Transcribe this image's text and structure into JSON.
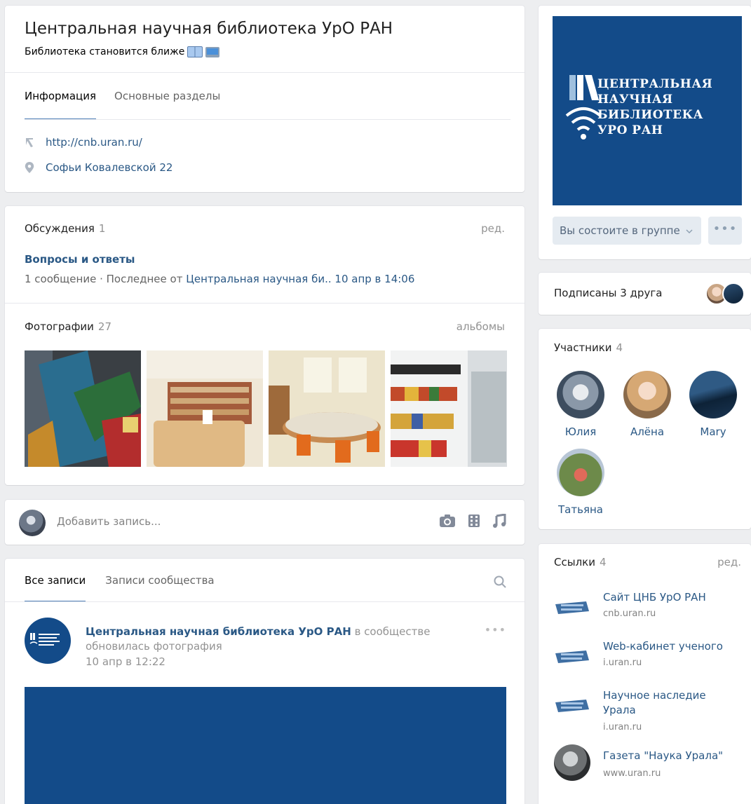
{
  "group": {
    "title": "Центральная научная библиотека УрО РАН",
    "status": "Библиотека становится ближе",
    "tabs": [
      "Информация",
      "Основные разделы"
    ],
    "website": "http://cnb.uran.ru/",
    "address": "Софьи Ковалевской 22"
  },
  "discussions": {
    "label": "Обсуждения",
    "count": "1",
    "edit": "ред.",
    "topic": "Вопросы и ответы",
    "meta_prefix": "1 сообщение · Последнее от ",
    "meta_author": "Центральная научная би..",
    "meta_date": " 10 апр в 14:06"
  },
  "photos": {
    "label": "Фотографии",
    "count": "27",
    "albums": "альбомы"
  },
  "add_post": {
    "placeholder": "Добавить запись..."
  },
  "wall": {
    "tabs": [
      "Все записи",
      "Записи сообщества"
    ],
    "post_author": "Центральная научная библиотека УрО РАН",
    "post_action": " в сообществе обновилась фотография",
    "post_date": "10 апр в 12:22",
    "more": "•••"
  },
  "cover": {
    "logo_lines": [
      "ЦЕНТРАЛЬНАЯ",
      "НАУЧНАЯ",
      "БИБЛИОТЕКА",
      "УРО РАН"
    ],
    "member_button": "Вы состоите в группе",
    "more": "•••"
  },
  "friends": {
    "label": "Подписаны 3 друга"
  },
  "members": {
    "label": "Участники",
    "count": "4",
    "names": [
      "Юлия",
      "Алёна",
      "Mary",
      "Татьяна"
    ]
  },
  "links": {
    "label": "Ссылки",
    "count": "4",
    "edit": "ред.",
    "items": [
      {
        "title": "Сайт ЦНБ УрО РАН",
        "sub": "cnb.uran.ru"
      },
      {
        "title": "Web-кабинет ученого",
        "sub": "i.uran.ru"
      },
      {
        "title": "Научное наследие Урала",
        "sub": "i.uran.ru"
      },
      {
        "title": "Газета \"Наука Урала\"",
        "sub": "www.uran.ru"
      }
    ]
  },
  "colors": {
    "brand_blue": "#134b89",
    "link": "#2a5885",
    "accent": "#5181b8",
    "background": "#edeef0"
  }
}
